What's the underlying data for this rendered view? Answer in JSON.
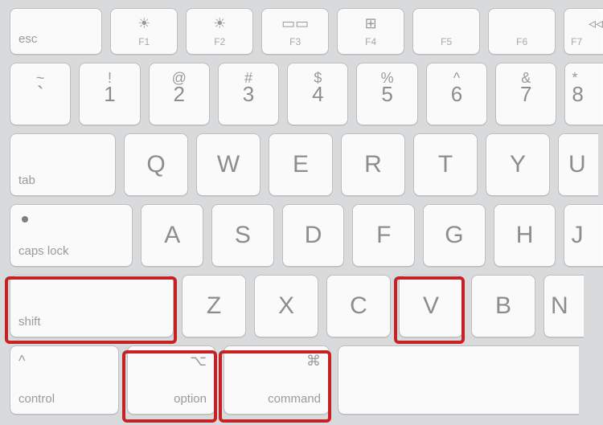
{
  "rows": {
    "fn": {
      "esc": "esc",
      "keys": [
        {
          "icon": "☀",
          "sub": "F1"
        },
        {
          "icon": "☀",
          "sub": "F2"
        },
        {
          "icon": "▭▭",
          "sub": "F3"
        },
        {
          "icon": "⊞",
          "sub": "F4"
        },
        {
          "icon": "",
          "sub": "F5"
        },
        {
          "icon": "",
          "sub": "F6"
        },
        {
          "icon": "◃◃",
          "sub": "F7"
        }
      ]
    },
    "num": [
      {
        "top": "~",
        "main": "`"
      },
      {
        "top": "!",
        "main": "1"
      },
      {
        "top": "@",
        "main": "2"
      },
      {
        "top": "#",
        "main": "3"
      },
      {
        "top": "$",
        "main": "4"
      },
      {
        "top": "%",
        "main": "5"
      },
      {
        "top": "^",
        "main": "6"
      },
      {
        "top": "&",
        "main": "7"
      },
      {
        "top": "*",
        "main": "8"
      }
    ],
    "qwerty": {
      "tab": "tab",
      "letters": [
        "Q",
        "W",
        "E",
        "R",
        "T",
        "Y",
        "U"
      ]
    },
    "asdf": {
      "caps": "caps lock",
      "letters": [
        "A",
        "S",
        "D",
        "F",
        "G",
        "H",
        "J"
      ]
    },
    "zxcv": {
      "shift": "shift",
      "letters": [
        "Z",
        "X",
        "C",
        "V",
        "B",
        "N"
      ]
    },
    "bottom": {
      "control": {
        "label": "control",
        "icon": "^"
      },
      "option": {
        "label": "option",
        "icon": "⌥"
      },
      "command": {
        "label": "command",
        "icon": "⌘"
      }
    }
  },
  "highlight_color": "#c62225"
}
